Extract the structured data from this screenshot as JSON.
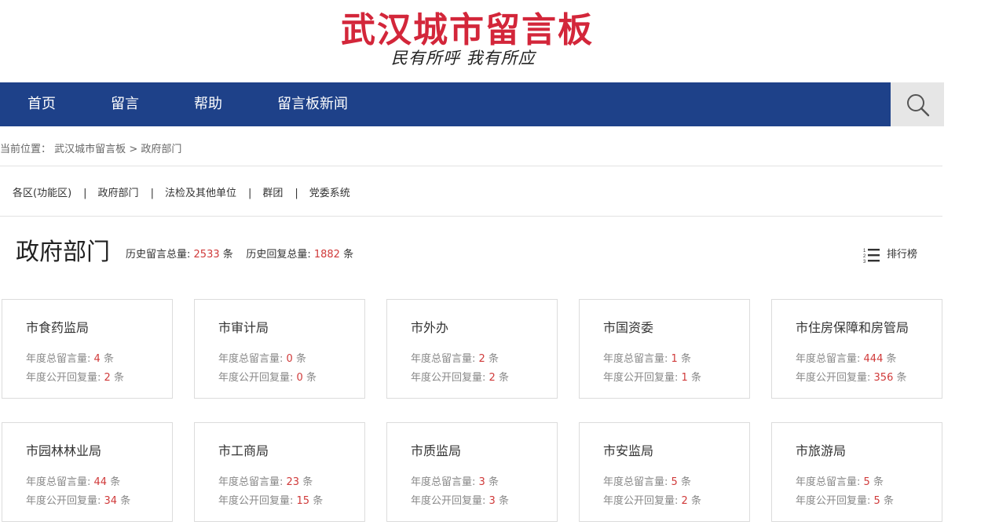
{
  "header": {
    "site_title": "武汉城市留言板",
    "slogan": "民有所呼 我有所应"
  },
  "nav": {
    "items": [
      {
        "label": "首页"
      },
      {
        "label": "留言"
      },
      {
        "label": "帮助"
      },
      {
        "label": "留言板新闻"
      }
    ],
    "search_icon": "search-icon"
  },
  "breadcrumb": {
    "prefix": "当前位置：",
    "home": "武汉城市留言板",
    "separator": ">",
    "current": "政府部门"
  },
  "categories": {
    "separator": "|",
    "items": [
      {
        "label": "各区(功能区)"
      },
      {
        "label": "政府部门"
      },
      {
        "label": "法检及其他单位"
      },
      {
        "label": "群团"
      },
      {
        "label": "党委系统"
      }
    ]
  },
  "section": {
    "title": "政府部门",
    "total_msg_label": "历史留言总量:",
    "total_msg_value": "2533",
    "total_reply_label": "历史回复总量:",
    "total_reply_value": "1882",
    "unit": "条",
    "rank_label": "排行榜"
  },
  "card_labels": {
    "msg_label": "年度总留言量:",
    "reply_label": "年度公开回复量:",
    "unit": "条"
  },
  "cards": [
    {
      "name": "市食药监局",
      "msg": "4",
      "reply": "2"
    },
    {
      "name": "市审计局",
      "msg": "0",
      "reply": "0"
    },
    {
      "name": "市外办",
      "msg": "2",
      "reply": "2"
    },
    {
      "name": "市国资委",
      "msg": "1",
      "reply": "1"
    },
    {
      "name": "市住房保障和房管局",
      "msg": "444",
      "reply": "356"
    },
    {
      "name": "市园林林业局",
      "msg": "44",
      "reply": "34"
    },
    {
      "name": "市工商局",
      "msg": "23",
      "reply": "15"
    },
    {
      "name": "市质监局",
      "msg": "3",
      "reply": "3"
    },
    {
      "name": "市安监局",
      "msg": "5",
      "reply": "2"
    },
    {
      "name": "市旅游局",
      "msg": "5",
      "reply": "5"
    }
  ],
  "colors": {
    "brand_red": "#d3263a",
    "nav_blue": "#1e4189",
    "number_red": "#d03a3a"
  }
}
